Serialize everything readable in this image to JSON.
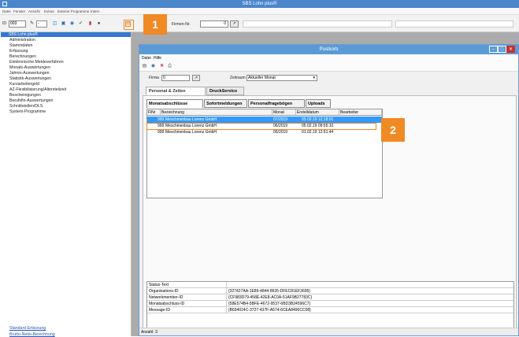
{
  "app": {
    "title": "SBS Lohn plus®",
    "menu": [
      "Datei",
      "Fenster",
      "Ansicht",
      "Extras",
      "Externe Programme",
      "Intern"
    ],
    "toolbar": {
      "id_label": "ID",
      "id_value": "003",
      "firmen_label": "Firmen-Nr.",
      "firmen_value": "0"
    }
  },
  "sidebar": {
    "header": "SBS Lohn plus®",
    "items": [
      "Administration",
      "Stammdaten",
      "Erfassung",
      "Berechnungen",
      "Elektronische Meldeverfahren",
      "Monats-Auswertungen",
      "Jahres-Auswertungen",
      "Statistik-Auswertungen",
      "Kurzarbeitergeld",
      "AZ-Flexibilisierung/Altersteilzeit",
      "Bescheinigungen",
      "Berufsfin-Auswertungen",
      "Schnittstellen/DLS",
      "System-Programme"
    ],
    "bottom_items": [
      "Standard-Erfassung",
      "Brutto-Netto-Berechnung"
    ]
  },
  "callouts": {
    "one": "1",
    "two": "2"
  },
  "postkorb": {
    "title": "Postkorb",
    "menu": [
      "Datei",
      "Hilfe"
    ],
    "filter": {
      "firma_label": "Firma",
      "firma_value": "0",
      "zeitraum_label": "Zeitraum",
      "zeitraum_value": "Aktueller Monat"
    },
    "tabs": [
      "Personal & Zeiten",
      "DruckService"
    ],
    "subtabs": [
      "Monatsabschlüsse",
      "Sofortmeldungen",
      "Personalfragebögen",
      "Uploads"
    ],
    "columns": [
      "FiNr",
      "Bezeichnung",
      "Monat",
      "Erstelldatum",
      "Bearbeiter"
    ],
    "rows": [
      {
        "finr": "999",
        "bezeichnung": "Meschinenbau Lorenz GmbH",
        "monat": "07/2019",
        "erstelldatum": "05.02.19 12:18:01",
        "bearbeiter": ""
      },
      {
        "finr": "999",
        "bezeichnung": "Meschinenbau Lorenz GmbH",
        "monat": "06/2019",
        "erstelldatum": "05.02.19 09:55:10",
        "bearbeiter": ""
      },
      {
        "finr": "999",
        "bezeichnung": "Meschinenbau Lorenz GmbH",
        "monat": "05/2019",
        "erstelldatum": "01.02.19 12:51:44",
        "bearbeiter": ""
      }
    ],
    "properties": [
      {
        "key": "Status-Text",
        "value": ""
      },
      {
        "key": "Organisations-ID",
        "value": "{327427AA-1E86-4844-8635-DFEC81EF3695}"
      },
      {
        "key": "Networkmember-ID",
        "value": "{CF983D79-458E-42E8-AC0A-51AF9B27783C}"
      },
      {
        "key": "Monatsabschluss-ID",
        "value": "{58E574B4-5BFE-4672-9537-6BD3B24596C7}"
      },
      {
        "key": "Message-ID",
        "value": "{B694024C-3727-437F-A574-6CEA8496CC08}"
      }
    ],
    "status": "Anzahl: 3"
  }
}
